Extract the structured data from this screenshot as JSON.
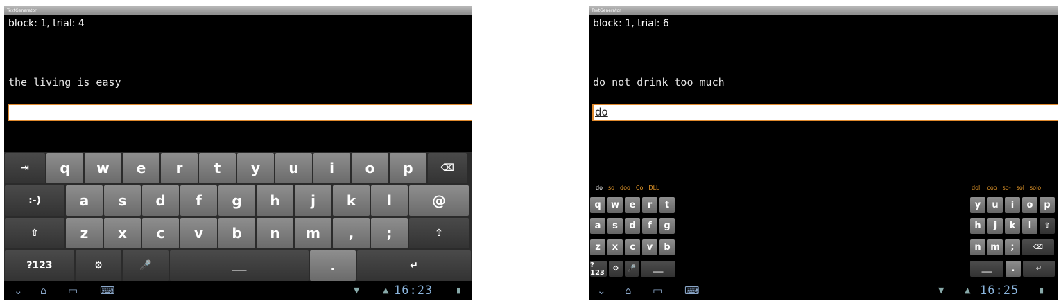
{
  "left": {
    "title": "TextGenerator",
    "trial": "block: 1, trial: 4",
    "phrase": "the living is easy",
    "input": "",
    "keyboard": {
      "row1": [
        "⇥",
        "q",
        "w",
        "e",
        "r",
        "t",
        "y",
        "u",
        "i",
        "o",
        "p",
        "⌫"
      ],
      "row2": [
        ":-)",
        "a",
        "s",
        "d",
        "f",
        "g",
        "h",
        "j",
        "k",
        "l",
        "@"
      ],
      "row3": [
        "⇧",
        "z",
        "x",
        "c",
        "v",
        "b",
        "n",
        "m",
        ",",
        ";",
        "⇧"
      ],
      "row4": [
        "?123",
        "⚙",
        "🎤",
        "___",
        ".",
        "↵"
      ]
    },
    "clock": "16:23"
  },
  "right": {
    "title": "TextGenerator",
    "trial": "block: 1, trial: 6",
    "phrase": "do not drink too much",
    "input": "do",
    "suggestions_left": [
      "do",
      "so",
      "doo",
      "Co",
      "DLL"
    ],
    "suggestions_right": [
      "doll",
      "coo",
      "so-",
      "sol",
      "solo"
    ],
    "left_keys": {
      "row1": [
        "q",
        "w",
        "e",
        "r",
        "t"
      ],
      "row2": [
        "a",
        "s",
        "d",
        "f",
        "g"
      ],
      "row3": [
        "z",
        "x",
        "c",
        "v",
        "b"
      ],
      "row4": [
        "?123",
        "⚙",
        "🎤",
        "___"
      ]
    },
    "right_keys": {
      "row1": [
        "y",
        "u",
        "i",
        "o",
        "p"
      ],
      "row2": [
        "h",
        "j",
        "k",
        "l",
        "⇧"
      ],
      "row3": [
        "n",
        "m",
        ";",
        "⌫"
      ],
      "row4": [
        "___",
        ".",
        "↵"
      ]
    },
    "clock": "16:25"
  },
  "icons": {
    "back": "⌄",
    "home": "⌂",
    "recent": "▭",
    "keyboard": "⌨",
    "wifi": "▼",
    "signal": "▲",
    "battery": "▮"
  }
}
